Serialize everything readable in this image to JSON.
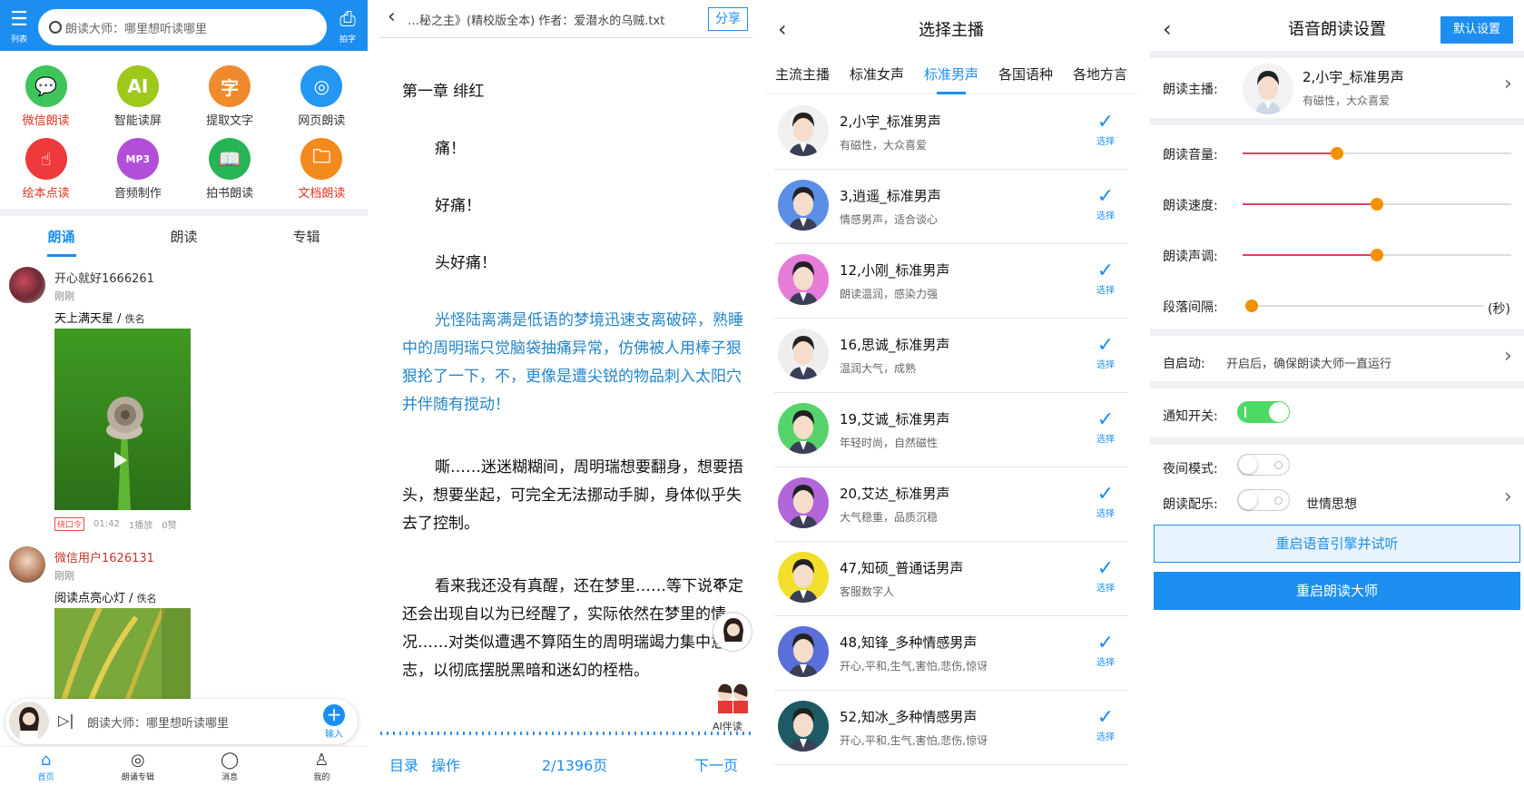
{
  "home": {
    "header": {
      "menu_label": "列表",
      "search_placeholder": "朗读大师：哪里想听读哪里",
      "camera_label": "拍字"
    },
    "features": [
      {
        "label": "微信朗读",
        "icon": "wechat-icon",
        "color": "#3ec45a",
        "glyph": "💬",
        "red": true
      },
      {
        "label": "智能读屏",
        "icon": "ai-screen-icon",
        "color": "#9ec81a",
        "glyph": "AI",
        "red": false
      },
      {
        "label": "提取文字",
        "icon": "extract-text-icon",
        "color": "#f18a2c",
        "glyph": "字",
        "red": false
      },
      {
        "label": "网页朗读",
        "icon": "browser-icon",
        "color": "#2497f2",
        "glyph": "◎",
        "red": false
      },
      {
        "label": "绘本点读",
        "icon": "finger-point-icon",
        "color": "#ee3a3a",
        "glyph": "☝",
        "red": true
      },
      {
        "label": "音频制作",
        "icon": "mp3-icon",
        "color": "#b24fd8",
        "glyph": "MP3",
        "red": false
      },
      {
        "label": "拍书朗读",
        "icon": "book-icon",
        "color": "#27b456",
        "glyph": "📖",
        "red": false
      },
      {
        "label": "文档朗读",
        "icon": "folder-icon",
        "color": "#f38a1e",
        "glyph": "🗀",
        "red": true
      }
    ],
    "tabs": [
      {
        "label": "朗诵"
      },
      {
        "label": "朗读"
      },
      {
        "label": "专辑"
      }
    ],
    "posts": [
      {
        "user": "开心就好1666261",
        "time": "刚刚",
        "work": "天上满天星",
        "anon": "佚名",
        "tag": "绕口令",
        "duration": "01:42",
        "plays": "1播放",
        "likes": "0赞"
      },
      {
        "user": "微信用户1626131",
        "time": "刚刚",
        "work": "阅读点亮心灯",
        "anon": "佚名"
      }
    ],
    "player": {
      "text": "朗读大师：哪里想听读哪里",
      "add_label": "输入"
    },
    "nav": [
      {
        "label": "首页"
      },
      {
        "label": "朗诵专辑"
      },
      {
        "label": "消息"
      },
      {
        "label": "我的"
      }
    ]
  },
  "reader": {
    "title": "…秘之主》(精校版全本) 作者：爱潜水的乌贼.txt",
    "share_label": "分享",
    "paragraphs": [
      "第一章 绯红",
      "痛！",
      "好痛！",
      "头好痛！",
      "光怪陆离满是低语的梦境迅速支离破碎，熟睡中的周明瑞只觉脑袋抽痛异常，仿佛被人用棒子狠狠抡了一下，不，更像是遭尖锐的物品刺入太阳穴并伴随有搅动！",
      "嘶……迷迷糊糊间，周明瑞想要翻身，想要捂头，想要坐起，可完全无法挪动手脚，身体似乎失去了控制。",
      "看来我还没有真醒，还在梦里……等下说不定还会出现自以为已经醒了，实际依然在梦里的情况……对类似遭遇不算陌生的周明瑞竭力集中意志，以彻底摆脱黑暗和迷幻的桎梏。"
    ],
    "ai_label": "AI伴读",
    "bottom": {
      "toc": "目录",
      "ops": "操作",
      "page": "2/1396页",
      "next": "下一页"
    }
  },
  "voices": {
    "title": "选择主播",
    "tabs": [
      {
        "label": "主流主播"
      },
      {
        "label": "标准女声"
      },
      {
        "label": "标准男声"
      },
      {
        "label": "各国语种"
      },
      {
        "label": "各地方言"
      }
    ],
    "select_label": "选择",
    "list": [
      {
        "name": "2,小宇_标准男声",
        "desc": "有磁性，大众喜爱",
        "bg": "#f0f0f0"
      },
      {
        "name": "3,逍遥_标准男声",
        "desc": "情感男声，适合谈心",
        "bg": "#5b8fe6"
      },
      {
        "name": "12,小刚_标准男声",
        "desc": "朗读温润，感染力强",
        "bg": "#e57cd8"
      },
      {
        "name": "16,思诚_标准男声",
        "desc": "温润大气，成熟",
        "bg": "#eeeeee"
      },
      {
        "name": "19,艾诚_标准男声",
        "desc": "年轻时尚，自然磁性",
        "bg": "#56d36b"
      },
      {
        "name": "20,艾达_标准男声",
        "desc": "大气稳重，品质沉稳",
        "bg": "#b266d9"
      },
      {
        "name": "47,知硕_普通话男声",
        "desc": "客服数字人",
        "bg": "#f2df2c"
      },
      {
        "name": "48,知锋_多种情感男声",
        "desc": "开心,平和,生气,害怕,悲伤,惊讶",
        "bg": "#5a6fd9"
      },
      {
        "name": "52,知冰_多种情感男声",
        "desc": "开心,平和,生气,害怕,悲伤,惊讶",
        "bg": "#1e5a63"
      }
    ]
  },
  "settings": {
    "title": "语音朗读设置",
    "default_label": "默认设置",
    "anchor_label": "朗读主播:",
    "anchor_name": "2,小宇_标准男声",
    "anchor_desc": "有磁性，大众喜爱",
    "volume_label": "朗读音量:",
    "volume": 0.35,
    "speed_label": "朗读速度:",
    "speed": 0.5,
    "pitch_label": "朗读声调:",
    "pitch": 0.5,
    "interval_label": "段落间隔:",
    "interval": 0.0,
    "interval_unit": "(秒)",
    "autostart_label": "自启动:",
    "autostart_desc": "开启后，确保朗读大师一直运行",
    "notify_label": "通知开关:",
    "notify_on": true,
    "night_label": "夜间模式:",
    "night_on": false,
    "music_label": "朗读配乐:",
    "music_on": false,
    "music_name": "世情思想",
    "restart_engine_label": "重启语音引擎并试听",
    "restart_app_label": "重启朗读大师"
  }
}
